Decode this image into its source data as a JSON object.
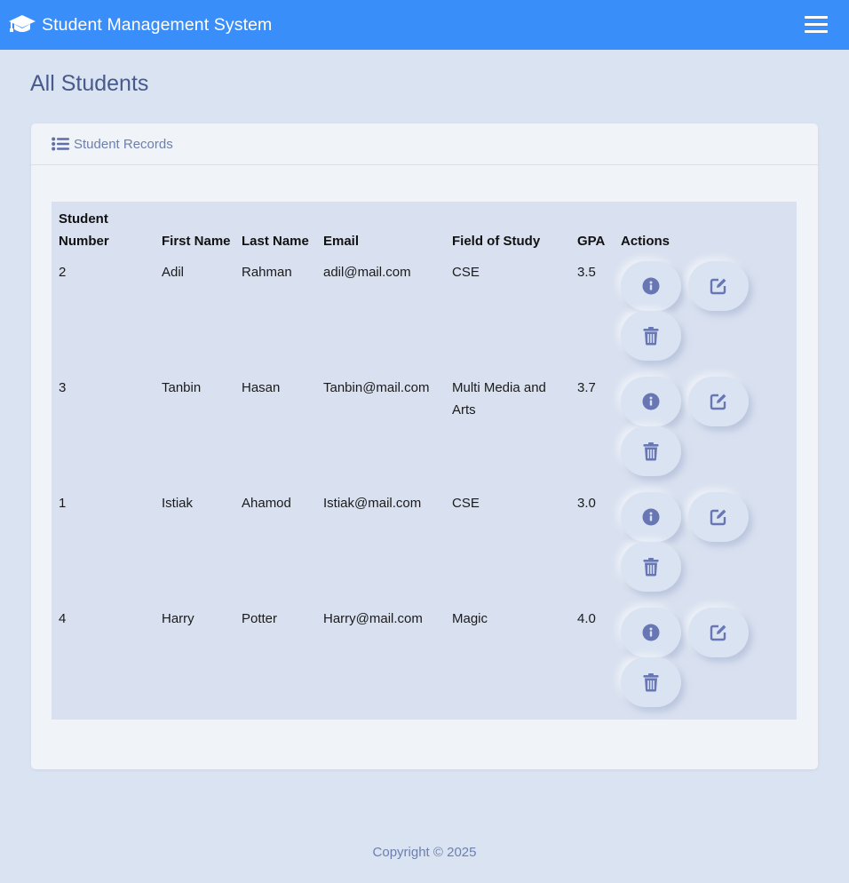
{
  "navbar": {
    "brand": "Student Management System",
    "brand_icon": "graduation-cap-icon",
    "menu_icon": "hamburger-menu-icon",
    "color": "#3a8ef9"
  },
  "page": {
    "title": "All Students"
  },
  "card": {
    "header": "Student Records",
    "header_icon": "list-icon"
  },
  "table": {
    "headers": {
      "student_number": "Student Number",
      "first_name": "First Name",
      "last_name": "Last Name",
      "email": "Email",
      "field": "Field of Study",
      "gpa": "GPA",
      "actions": "Actions"
    },
    "rows": [
      {
        "number": "2",
        "first": "Adil",
        "last": "Rahman",
        "email": "adil@mail.com",
        "field": "CSE",
        "gpa": "3.5"
      },
      {
        "number": "3",
        "first": "Tanbin",
        "last": "Hasan",
        "email": "Tanbin@mail.com",
        "field": "Multi Media and Arts",
        "gpa": "3.7"
      },
      {
        "number": "1",
        "first": "Istiak",
        "last": "Ahamod",
        "email": "Istiak@mail.com",
        "field": "CSE",
        "gpa": "3.0"
      },
      {
        "number": "4",
        "first": "Harry",
        "last": "Potter",
        "email": "Harry@mail.com",
        "field": "Magic",
        "gpa": "4.0"
      }
    ],
    "action_icons": [
      "info-icon",
      "edit-icon",
      "trash-icon"
    ]
  },
  "footer": {
    "copyright": "Copyright © 2025"
  }
}
